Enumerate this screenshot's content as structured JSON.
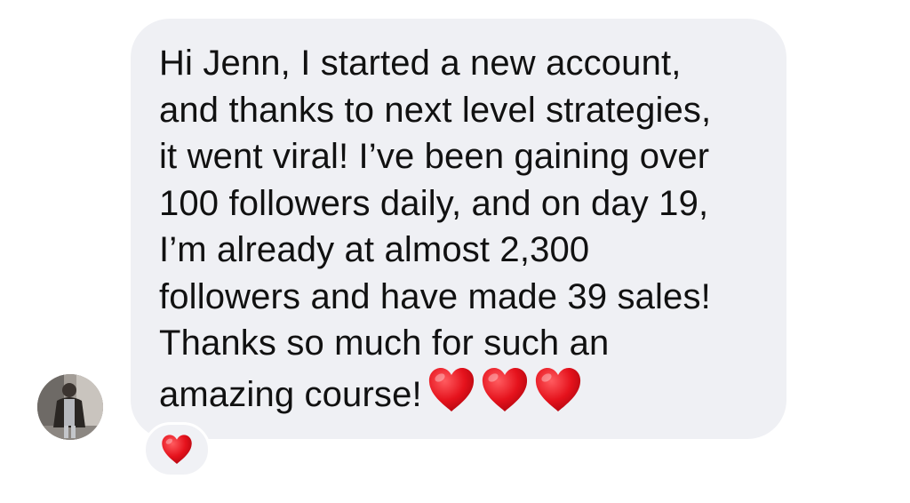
{
  "message": {
    "lines": [
      "Hi Jenn, I started a new account,",
      "and thanks to next level strategies,",
      "it went viral! I’ve been gaining over",
      "100 followers daily, and on day 19,",
      "I’m already at almost 2,300",
      "followers and have made 39 sales!",
      "Thanks so much for such an",
      "amazing course!"
    ],
    "trailing_emoji": [
      "red-heart",
      "red-heart",
      "red-heart"
    ]
  },
  "reaction": {
    "emoji": "red-heart"
  },
  "colors": {
    "bubble": "#eff0f4",
    "text": "#111111",
    "heart": "#e5121c",
    "background": "#ffffff"
  }
}
